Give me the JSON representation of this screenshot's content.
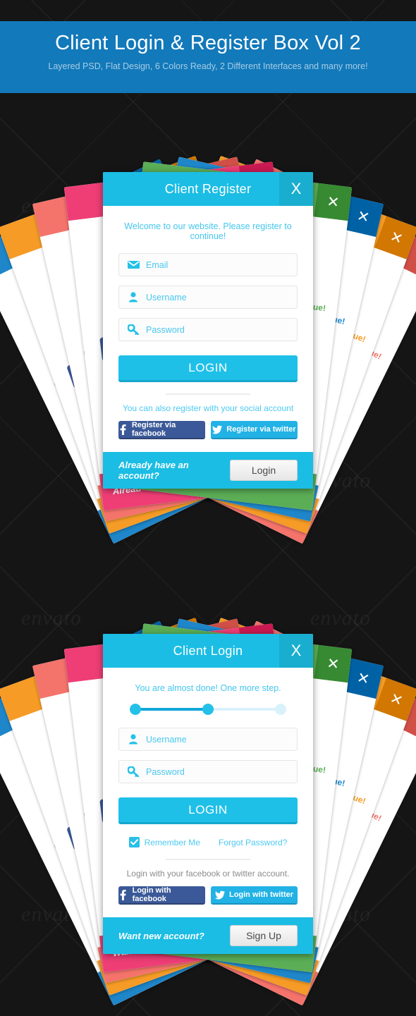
{
  "banner": {
    "title": "Client Login & Register Box Vol 2",
    "subtitle": "Layered PSD, Flat Design, 6 Colors Ready, 2 Different Interfaces and many more!"
  },
  "watermark": {
    "text": "envato"
  },
  "colors": {
    "cyan": "#1bbde4",
    "cyan_dark": "#19aecf",
    "banner_blue": "#1279ba",
    "facebook": "#3b5998",
    "twitter": "#22b2e5",
    "background": "#151515",
    "label_cyan": "#49c7ef"
  },
  "register_card": {
    "title": "Client Register",
    "close_label": "X",
    "welcome": "Welcome to our website. Please register to continue!",
    "fields": [
      {
        "label": "Email",
        "icon": "envelope-icon"
      },
      {
        "label": "Username",
        "icon": "user-icon"
      },
      {
        "label": "Password",
        "icon": "key-icon"
      }
    ],
    "submit_label": "LOGIN",
    "social_note": "You can also register with your social account",
    "social": [
      {
        "label": "Register via facebook",
        "icon": "facebook-icon"
      },
      {
        "label": "Register via twitter",
        "icon": "twitter-icon"
      }
    ],
    "footer_text": "Already have an account?",
    "footer_button": "Login",
    "fan_colors": [
      "#1e86c9",
      "#f59b26",
      "#f4736b",
      "#ef3e76",
      "#5bae56"
    ],
    "fan_footer_text": "Alread"
  },
  "login_card": {
    "title": "Client Login",
    "close_label": "X",
    "progress_text": "You are almost done! One more step.",
    "progress": {
      "steps": 3,
      "completed": 2,
      "percent": 50
    },
    "fields": [
      {
        "label": "Username",
        "icon": "user-icon"
      },
      {
        "label": "Password",
        "icon": "key-icon"
      }
    ],
    "submit_label": "LOGIN",
    "remember_label": "Remember Me",
    "remember_checked": true,
    "forgot_label": "Forgot Password?",
    "social_note": "Login with your facebook or twitter account.",
    "social": [
      {
        "label": "Login with facebook",
        "icon": "facebook-icon"
      },
      {
        "label": "Login with twitter",
        "icon": "twitter-icon"
      }
    ],
    "footer_text": "Want new account?",
    "footer_button": "Sign Up",
    "fan_colors": [
      "#1e86c9",
      "#f59b26",
      "#f4736b",
      "#ef3e76",
      "#5bae56"
    ],
    "fan_footer_text": "Wan"
  }
}
